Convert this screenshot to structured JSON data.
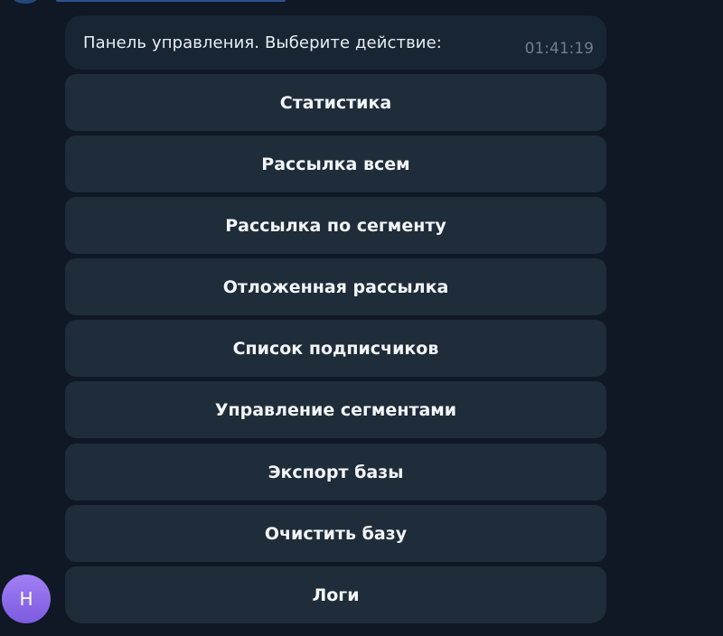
{
  "message": {
    "text": "Панель управления. Выберите действие:",
    "time": "01:41:19"
  },
  "keyboard": {
    "buttons": [
      {
        "label": "Статистика"
      },
      {
        "label": "Рассылка всем"
      },
      {
        "label": "Рассылка по сегменту"
      },
      {
        "label": "Отложенная рассылка"
      },
      {
        "label": "Список подписчиков"
      },
      {
        "label": "Управление сегментами"
      },
      {
        "label": "Экспорт базы"
      },
      {
        "label": "Очистить базу"
      },
      {
        "label": "Логи"
      }
    ]
  },
  "avatar": {
    "letter": "Н",
    "color": "#8e6cf0"
  },
  "colors": {
    "background": "#0f1824",
    "bubble": "#182533",
    "button": "#1f2c39",
    "text": "#f3f6f9",
    "time": "#6d7f8f"
  }
}
